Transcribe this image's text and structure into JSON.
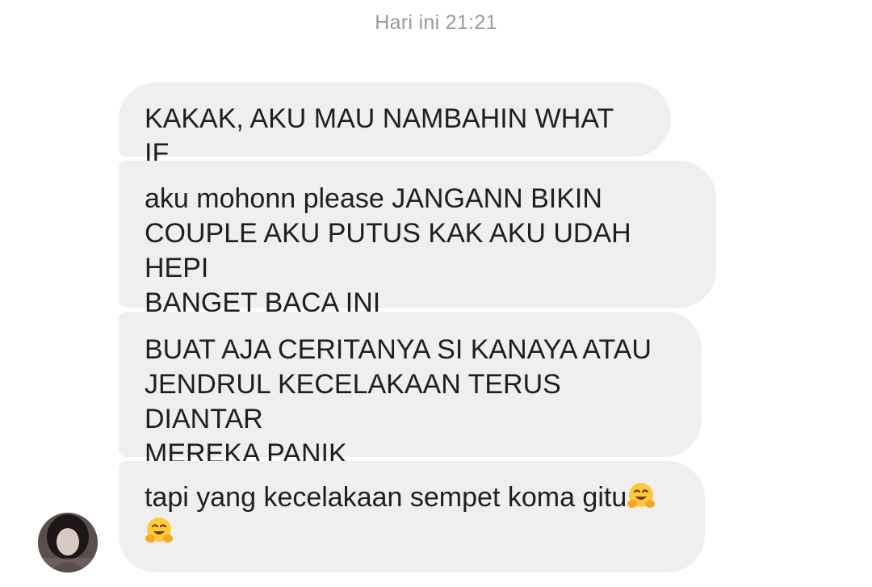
{
  "thread": {
    "timestamp": "Hari ini 21:21"
  },
  "messages": [
    {
      "text": "KAKAK, AKU MAU NAMBAHIN WHAT IF"
    },
    {
      "text": "aku mohonn please JANGANN BIKIN\nCOUPLE AKU PUTUS KAK AKU UDAH HEPI\nBANGET BACA INI"
    },
    {
      "text": "BUAT AJA CERITANYA SI KANAYA ATAU\nJENDRUL KECELAKAAN TERUS DIANTAR\nMEREKA PANIK"
    },
    {
      "text": "tapi yang kecelakaan sempet koma gitu",
      "emoji": "hugging-face-emoji"
    }
  ],
  "colors": {
    "bubble_bg": "#efefef",
    "text": "#1f1f1f",
    "timestamp": "#9a9a9a",
    "background": "#ffffff"
  },
  "icons": {
    "sender_avatar": "profile-photo"
  }
}
